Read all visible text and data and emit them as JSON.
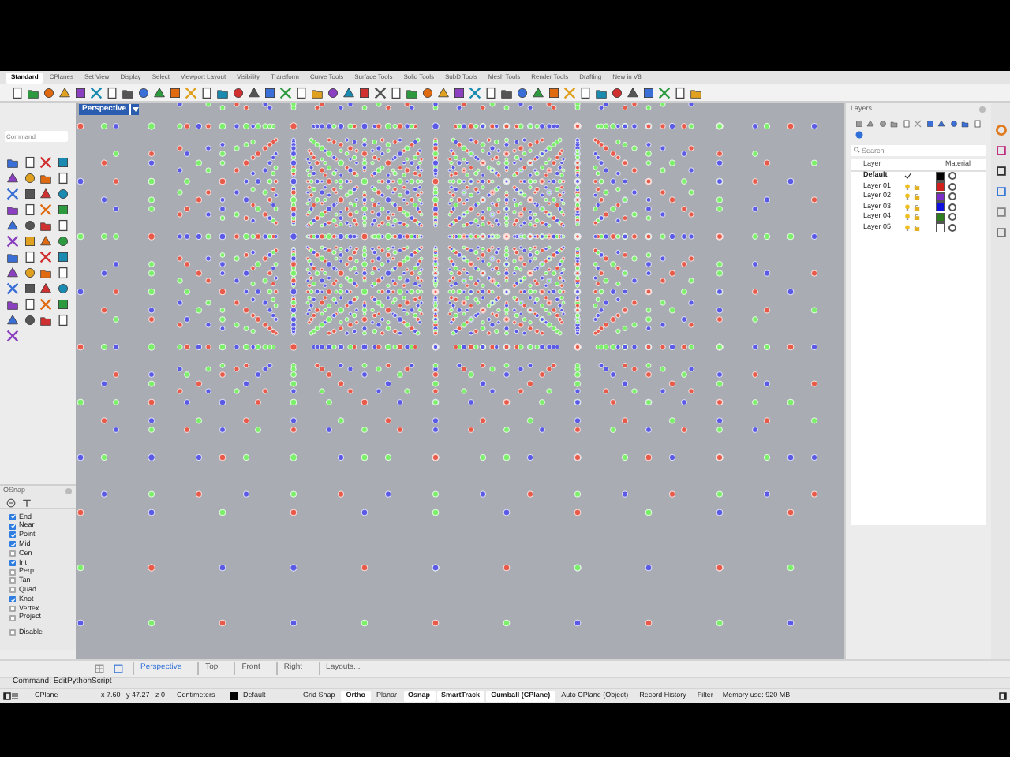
{
  "ribbon_tabs": [
    {
      "label": "Standard",
      "selected": true
    },
    {
      "label": "CPlanes",
      "selected": false
    },
    {
      "label": "Set View",
      "selected": false
    },
    {
      "label": "Display",
      "selected": false
    },
    {
      "label": "Select",
      "selected": false
    },
    {
      "label": "Viewport Layout",
      "selected": false
    },
    {
      "label": "Visibility",
      "selected": false
    },
    {
      "label": "Transform",
      "selected": false
    },
    {
      "label": "Curve Tools",
      "selected": false
    },
    {
      "label": "Surface Tools",
      "selected": false
    },
    {
      "label": "Solid Tools",
      "selected": false
    },
    {
      "label": "SubD Tools",
      "selected": false
    },
    {
      "label": "Mesh Tools",
      "selected": false
    },
    {
      "label": "Render Tools",
      "selected": false
    },
    {
      "label": "Drafting",
      "selected": false
    },
    {
      "label": "New in V8",
      "selected": false
    }
  ],
  "command_field": {
    "placeholder": "Command"
  },
  "osnap": {
    "title": "OSnap",
    "items": [
      {
        "label": "End",
        "checked": true
      },
      {
        "label": "Near",
        "checked": true
      },
      {
        "label": "Point",
        "checked": true
      },
      {
        "label": "Mid",
        "checked": true
      },
      {
        "label": "Cen",
        "checked": false
      },
      {
        "label": "Int",
        "checked": true
      },
      {
        "label": "Perp",
        "checked": false
      },
      {
        "label": "Tan",
        "checked": false
      },
      {
        "label": "Quad",
        "checked": false
      },
      {
        "label": "Knot",
        "checked": true
      },
      {
        "label": "Vertex",
        "checked": false
      },
      {
        "label": "Project",
        "checked": false
      }
    ],
    "disable": {
      "label": "Disable",
      "checked": false
    }
  },
  "viewport": {
    "title": "Perspective"
  },
  "viewport_tabs": [
    {
      "label": "Perspective",
      "selected": true
    },
    {
      "label": "Top",
      "selected": false
    },
    {
      "label": "Front",
      "selected": false
    },
    {
      "label": "Right",
      "selected": false
    },
    {
      "label": "Layouts...",
      "selected": false
    }
  ],
  "command_line": {
    "text": "Command: EditPythonScript"
  },
  "status_bar": {
    "cplane": "CPlane",
    "coords": "x 7.60   y 47.27   z 0",
    "units": "Centimeters",
    "layer": "Default",
    "toggles": [
      {
        "label": "Grid Snap",
        "on": false
      },
      {
        "label": "Ortho",
        "on": true
      },
      {
        "label": "Planar",
        "on": false
      },
      {
        "label": "Osnap",
        "on": true
      },
      {
        "label": "SmartTrack",
        "on": true
      },
      {
        "label": "Gumball (CPlane)",
        "on": true
      },
      {
        "label": "Auto CPlane (Object)",
        "on": false
      },
      {
        "label": "Record History",
        "on": false
      },
      {
        "label": "Filter",
        "on": false
      }
    ],
    "memory": "Memory use: 920 MB"
  },
  "layers_panel": {
    "title": "Layers",
    "search": {
      "placeholder": "Search"
    },
    "columns": [
      "Layer",
      "Material"
    ],
    "layers": [
      {
        "name": "Default",
        "current": true,
        "color": "#000000"
      },
      {
        "name": "Layer 01",
        "current": false,
        "color": "#d0201c"
      },
      {
        "name": "Layer 02",
        "current": false,
        "color": "#7b2fc8"
      },
      {
        "name": "Layer 03",
        "current": false,
        "color": "#1010e0"
      },
      {
        "name": "Layer 04",
        "current": false,
        "color": "#2e7d1e"
      },
      {
        "name": "Layer 05",
        "current": false,
        "color": "#ffffff"
      }
    ]
  }
}
